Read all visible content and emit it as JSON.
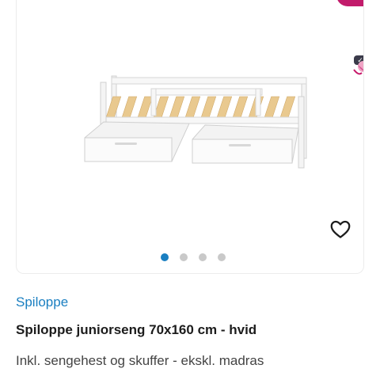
{
  "listing": {
    "seller": "Spiloppe",
    "title": "Spiloppe juniorseng 70x160 cm - hvid",
    "subtitle": "Inkl. sengehest og skuffer - ekskl. madras"
  },
  "gallery": {
    "image_count": 4,
    "active_index": 0,
    "favorite_icon": "heart-outline-icon"
  },
  "colors": {
    "accent_link": "#1a7fc1",
    "active_dot": "#1a7fc1",
    "inactive_dot": "#c9c9c9",
    "title_text": "#1c1c1c",
    "corner_accent": "#c21b6b"
  }
}
